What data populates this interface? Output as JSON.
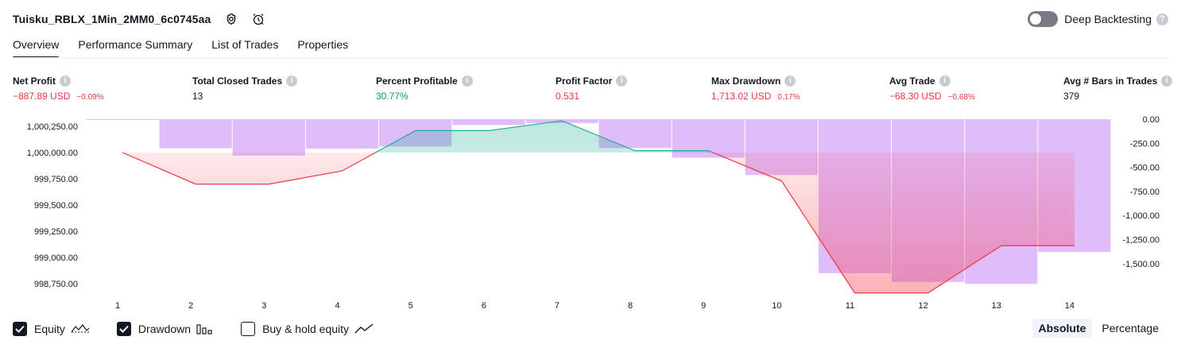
{
  "header": {
    "title": "Tuisku_RBLX_1Min_2MM0_6c0745aa",
    "deep_backtesting_label": "Deep Backtesting"
  },
  "tabs": [
    {
      "label": "Overview",
      "active": true
    },
    {
      "label": "Performance Summary",
      "active": false
    },
    {
      "label": "List of Trades",
      "active": false
    },
    {
      "label": "Properties",
      "active": false
    }
  ],
  "metrics": [
    {
      "label": "Net Profit",
      "value": "−887.89 USD",
      "sub": "−0.09%",
      "tone": "neg"
    },
    {
      "label": "Total Closed Trades",
      "value": "13",
      "sub": "",
      "tone": "neu"
    },
    {
      "label": "Percent Profitable",
      "value": "30.77%",
      "sub": "",
      "tone": "pos"
    },
    {
      "label": "Profit Factor",
      "value": "0.531",
      "sub": "",
      "tone": "neg"
    },
    {
      "label": "Max Drawdown",
      "value": "1,713.02 USD",
      "sub": "0.17%",
      "tone": "neg"
    },
    {
      "label": "Avg Trade",
      "value": "−68.30 USD",
      "sub": "−0.68%",
      "tone": "neg"
    },
    {
      "label": "Avg # Bars in Trades",
      "value": "379",
      "sub": "",
      "tone": "neu"
    }
  ],
  "chart_data": {
    "type": "line",
    "x": [
      1,
      2,
      3,
      4,
      5,
      6,
      7,
      8,
      9,
      10,
      11,
      12,
      13,
      14
    ],
    "series": [
      {
        "name": "Equity",
        "axis": "left",
        "values": [
          1000000,
          999699,
          999699,
          999825,
          1000209,
          1000209,
          1000303,
          1000018,
          1000018,
          999730,
          998661,
          998661,
          999112,
          999112
        ]
      },
      {
        "name": "Drawdown",
        "axis": "right",
        "type": "bar",
        "values": [
          0,
          -302,
          -378,
          -305,
          -285,
          -60,
          -40,
          -300,
          -400,
          -580,
          -1600,
          -1690,
          -1710,
          -1380
        ]
      }
    ],
    "equity_baseline": 1000000,
    "left_ticks": [
      "1,000,250.00",
      "1,000,000.00",
      "999,750.00",
      "999,500.00",
      "999,250.00",
      "999,000.00",
      "998,750.00"
    ],
    "left_tick_values": [
      1000250,
      1000000,
      999750,
      999500,
      999250,
      999000,
      998750
    ],
    "right_ticks": [
      "0.00",
      "-250.00",
      "-500.00",
      "-750.00",
      "-1,000.00",
      "-1,250.00",
      "-1,500.00"
    ],
    "right_tick_values": [
      0,
      -250,
      -500,
      -750,
      -1000,
      -1250,
      -1500
    ],
    "colors": {
      "equity_up": "#22ab94",
      "equity_down": "#f23645",
      "drawdown": "#ce93f8"
    }
  },
  "legend": {
    "items": [
      {
        "label": "Equity",
        "checked": true,
        "icon": "equity-icon"
      },
      {
        "label": "Drawdown",
        "checked": true,
        "icon": "drawdown-bars-icon"
      },
      {
        "label": "Buy & hold equity",
        "checked": false,
        "icon": "buy-hold-icon"
      }
    ]
  },
  "mode": {
    "absolute": "Absolute",
    "percentage": "Percentage",
    "selected": "Absolute"
  }
}
